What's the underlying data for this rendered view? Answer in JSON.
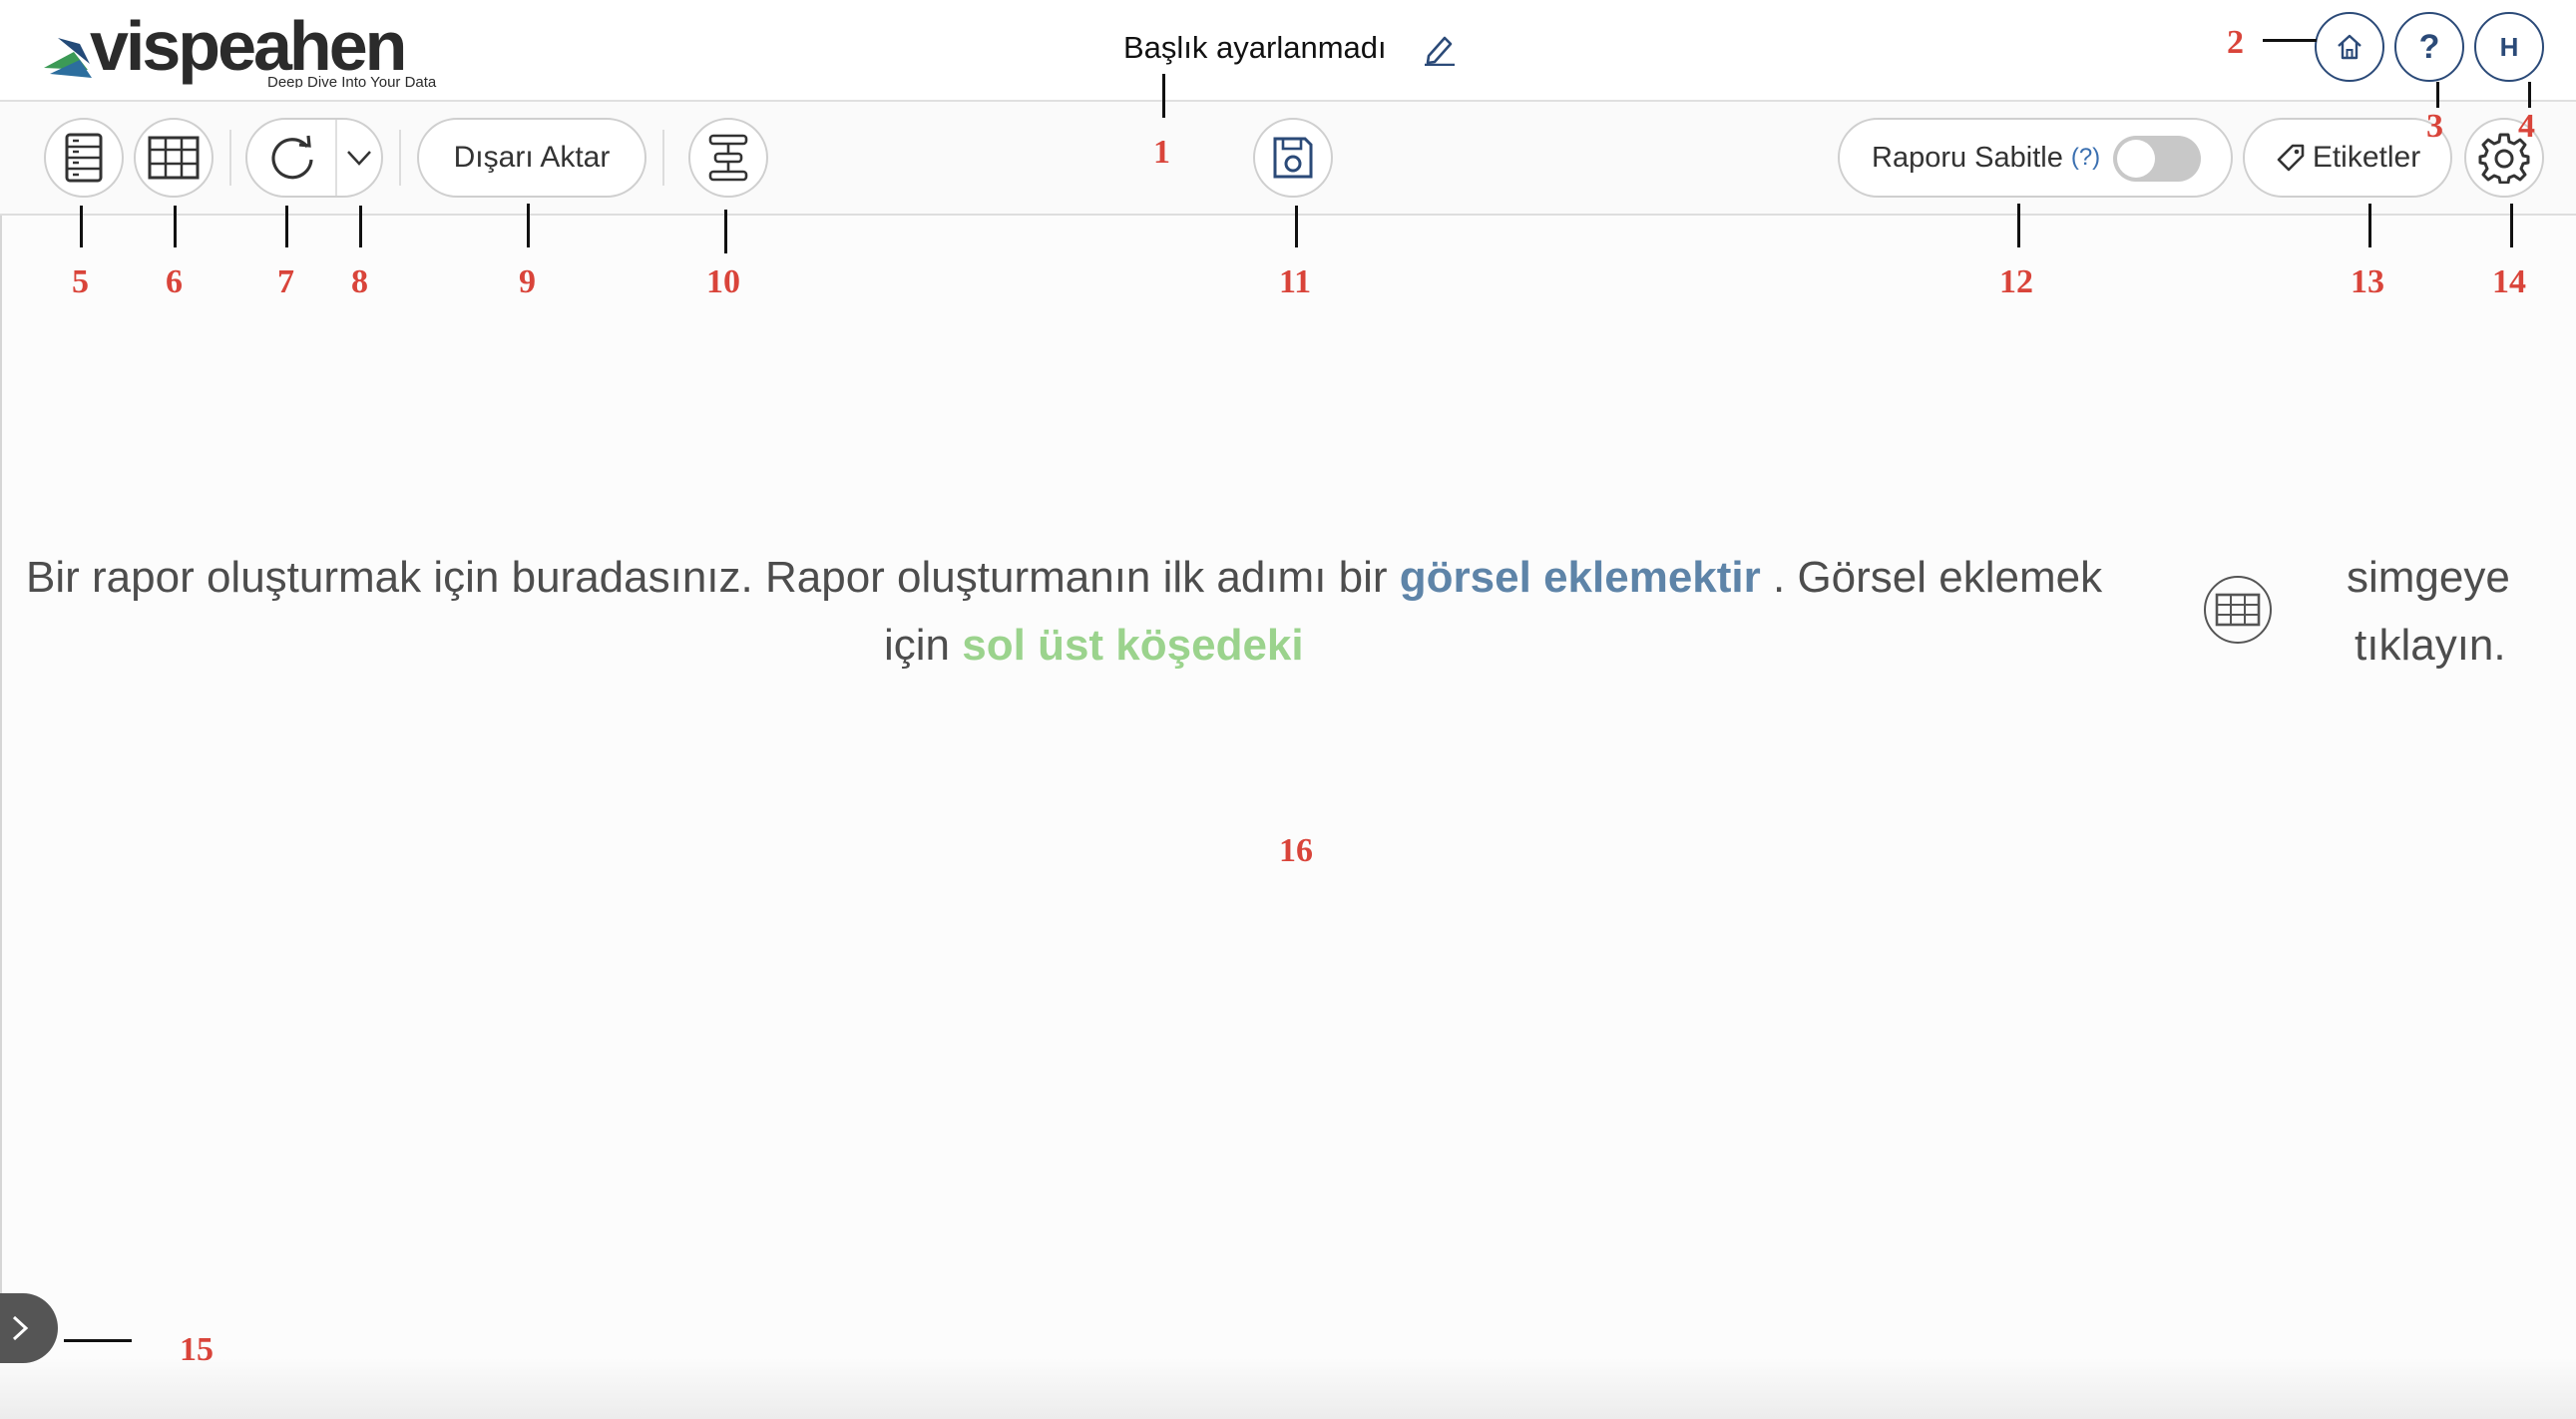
{
  "header": {
    "logo_text": "vispeahen",
    "logo_tagline": "Deep Dive Into Your Data",
    "title": "Başlık ayarlanmadı",
    "avatar_initial": "H",
    "help_label": "?"
  },
  "toolbar": {
    "export_label": "Dışarı Aktar",
    "pin_report_label": "Raporu Sabitle",
    "pin_report_help": "(?)",
    "pin_report_enabled": false,
    "tags_label": "Etiketler"
  },
  "message": {
    "part1": "Bir rapor oluşturmak için buradasınız. Rapor oluşturmanın ilk adımı bir",
    "highlight1": "görsel eklemektir",
    "part2": ". Görsel eklemek",
    "part3": "için",
    "highlight2": "sol üst köşedeki",
    "part4a": "simgeye",
    "part4b": "tıklayın."
  },
  "annotations": [
    "1",
    "2",
    "3",
    "4",
    "5",
    "6",
    "7",
    "8",
    "9",
    "10",
    "11",
    "12",
    "13",
    "14",
    "15",
    "16"
  ],
  "colors": {
    "annotation": "#d9443a",
    "brand_blue": "#2b4a78",
    "highlight_blue": "#5e84a8",
    "highlight_green": "#9bd38d",
    "logo_green": "#6aa84f"
  },
  "icons": [
    "home-icon",
    "help-icon",
    "avatar",
    "settings-icon",
    "data-source-icon",
    "table-icon",
    "refresh-icon",
    "chevron-down-icon",
    "filter-icon",
    "save-icon",
    "tag-icon",
    "edit-pencil-icon",
    "chevron-right-icon"
  ]
}
